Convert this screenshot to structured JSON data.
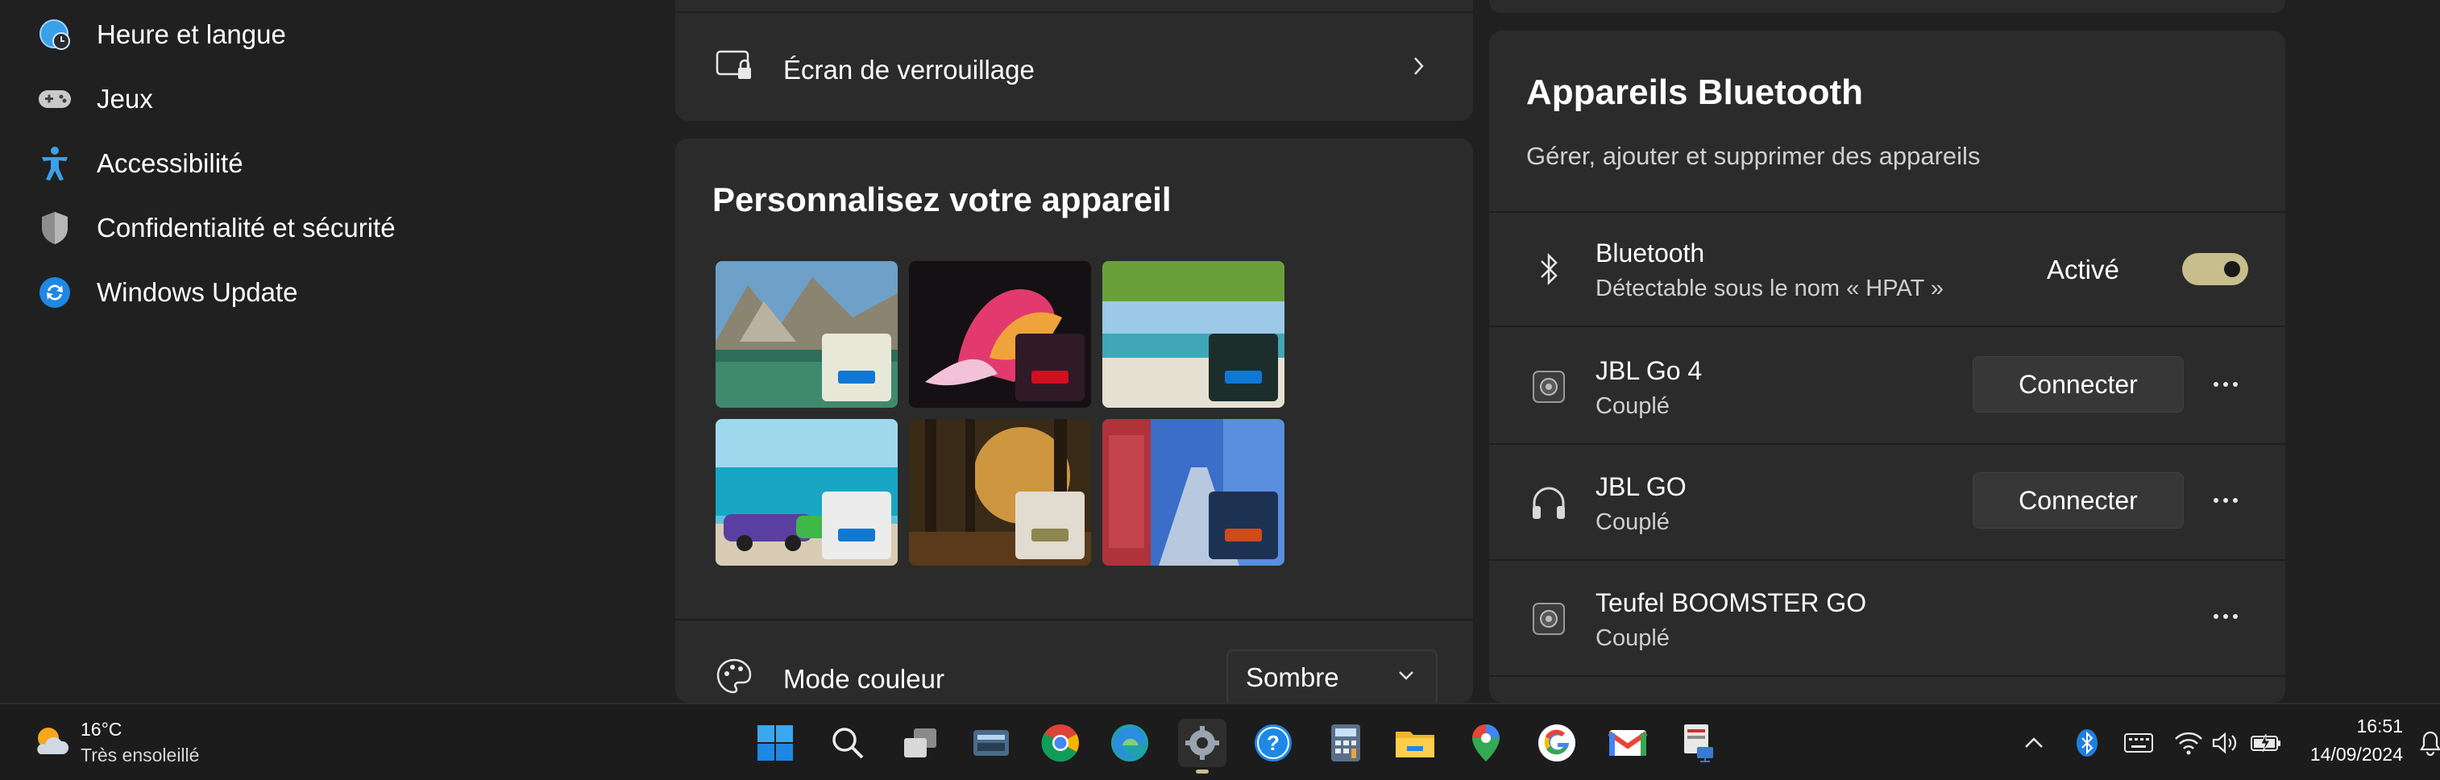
{
  "sidebar": {
    "items": [
      {
        "label": "Heure et langue",
        "icon": "globe-clock-icon"
      },
      {
        "label": "Jeux",
        "icon": "gamepad-icon"
      },
      {
        "label": "Accessibilité",
        "icon": "accessibility-icon"
      },
      {
        "label": "Confidentialité et sécurité",
        "icon": "shield-icon"
      },
      {
        "label": "Windows Update",
        "icon": "update-icon"
      }
    ]
  },
  "lock_screen": {
    "label": "Écran de verrouillage",
    "icon": "lock-screen-icon"
  },
  "personalize": {
    "title": "Personnalisez votre appareil",
    "themes": [
      {
        "name": "mountain-lake-theme",
        "accent": "#0f78d4",
        "window": "#e8e8d8"
      },
      {
        "name": "flower-abstract-theme",
        "accent": "#d20f1e",
        "window": "#2f1a26"
      },
      {
        "name": "beach-theme",
        "accent": "#0f78d4",
        "window": "#1c2e2c"
      },
      {
        "name": "car-beach-theme",
        "accent": "#0f78d4",
        "window": "#ececec"
      },
      {
        "name": "forest-sunrise-theme",
        "accent": "#8d8650",
        "window": "#e2dbcf"
      },
      {
        "name": "blue-street-theme",
        "accent": "#d04a1a",
        "window": "#1d3253"
      }
    ],
    "color_mode": {
      "label": "Mode couleur",
      "value": "Sombre"
    }
  },
  "bluetooth": {
    "title": "Appareils Bluetooth",
    "description": "Gérer, ajouter et supprimer des appareils",
    "main": {
      "name": "Bluetooth",
      "subtitle": "Détectable sous le nom « HPAT »",
      "state": "Activé"
    },
    "devices": [
      {
        "name": "JBL Go 4",
        "status": "Couplé",
        "action": "Connecter",
        "icon": "speaker-icon"
      },
      {
        "name": "JBL GO",
        "status": "Couplé",
        "action": "Connecter",
        "icon": "headphones-icon"
      },
      {
        "name": "Teufel BOOMSTER GO",
        "status": "Couplé",
        "icon": "speaker-icon"
      }
    ]
  },
  "taskbar": {
    "weather": {
      "temp": "16°C",
      "desc": "Très ensoleillé"
    },
    "clock": {
      "time": "16:51",
      "date": "14/09/2024"
    }
  },
  "colors": {
    "accent_toggle": "#c8bd8c",
    "background": "#202020",
    "card": "#2b2b2b"
  }
}
